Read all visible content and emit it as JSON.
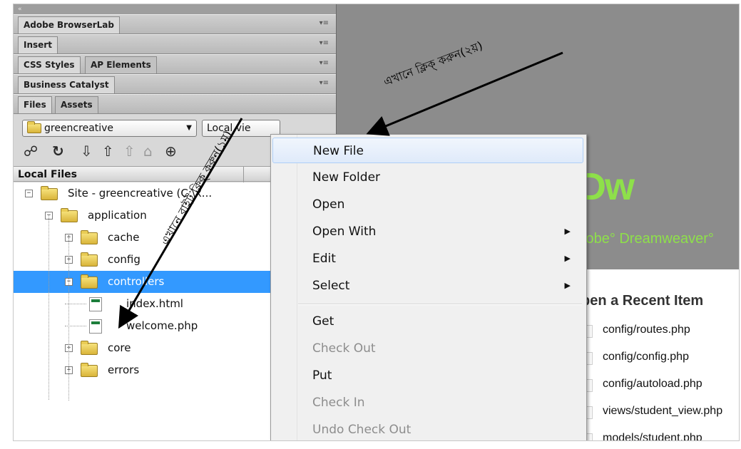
{
  "panels": {
    "collapse": "«",
    "browserlab": "Adobe BrowserLab",
    "insert": "Insert",
    "css_styles": "CSS Styles",
    "ap_elements": "AP Elements",
    "business_catalyst": "Business Catalyst",
    "files": "Files",
    "assets": "Assets",
    "menu_glyph": "▾≡"
  },
  "files_panel": {
    "site_select": "greencreative",
    "view_select": "Local vie",
    "local_files_header": "Local Files"
  },
  "tree": [
    {
      "label": "Site - greencreative (C:\\x...",
      "type": "folder",
      "expander": "−"
    },
    {
      "label": "application",
      "type": "folder",
      "expander": "−"
    },
    {
      "label": "cache",
      "type": "folder",
      "expander": "+"
    },
    {
      "label": "config",
      "type": "folder",
      "expander": "+"
    },
    {
      "label": "controllers",
      "type": "folder",
      "expander": "−",
      "selected": true
    },
    {
      "label": "index.html",
      "type": "file"
    },
    {
      "label": "welcome.php",
      "type": "file"
    },
    {
      "label": "core",
      "type": "folder",
      "expander": "+"
    },
    {
      "label": "errors",
      "type": "folder",
      "expander": "+"
    }
  ],
  "context_menu": {
    "items": [
      {
        "label": "New File",
        "hover": true
      },
      {
        "label": "New Folder"
      },
      {
        "label": "Open"
      },
      {
        "label": "Open With",
        "submenu": true
      },
      {
        "label": "Edit",
        "submenu": true
      },
      {
        "label": "Select",
        "submenu": true
      },
      {
        "label": "Get"
      },
      {
        "label": "Check Out",
        "disabled": true
      },
      {
        "label": "Put"
      },
      {
        "label": "Check In",
        "disabled": true
      },
      {
        "label": "Undo Check Out",
        "disabled": true
      }
    ],
    "submenu_glyph": "▶"
  },
  "welcome": {
    "logo": "Dw",
    "product": "lobe° Dreamweaver°",
    "recent_title": "pen a Recent Item",
    "recent_items": [
      "config/routes.php",
      "config/config.php",
      "config/autoload.php",
      "views/student_view.php",
      "models/student.php"
    ]
  },
  "annotations": {
    "second": "এখানে ক্লিক্ করুন(২য়)",
    "first": "এখানে রাইট ক্লিক্ করুন(১ম)"
  },
  "colors": {
    "selection": "#3399ff",
    "banner": "#0c2e0a",
    "dw_green": "#8ee04a",
    "menu_bg": "#f0f0f0"
  }
}
